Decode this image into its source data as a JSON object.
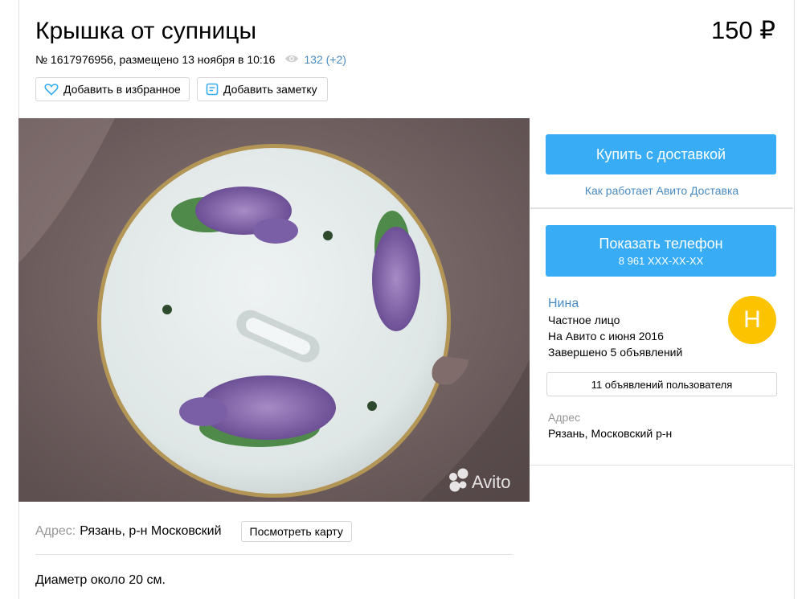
{
  "listing": {
    "title": "Крышка от супницы",
    "price": "150 ₽",
    "meta_text": "№ 1617976956, размещено 13 ноября в 10:16",
    "views": "132 (+2)",
    "favorite_label": "Добавить в избранное",
    "note_label": "Добавить заметку"
  },
  "photo": {
    "watermark": "Avito"
  },
  "delivery": {
    "buy_label": "Купить с доставкой",
    "how_link": "Как работает Авито Доставка"
  },
  "contact": {
    "show_phone_label": "Показать телефон",
    "phone_masked": "8 961 XXX-XX-XX"
  },
  "seller": {
    "name": "Нина",
    "type": "Частное лицо",
    "since": "На Авито с июня 2016",
    "completed": "Завершено 5 объявлений",
    "avatar_letter": "Н",
    "all_ads_label": "11 объявлений пользователя",
    "address_label": "Адрес",
    "address": "Рязань, Московский р-н"
  },
  "location": {
    "label": "Адрес:",
    "value": "Рязань, р-н Московский",
    "map_button": "Посмотреть карту"
  },
  "description": "Диаметр около 20 см.",
  "colors": {
    "accent": "#38adf5",
    "link": "#4a8bc2",
    "avatar": "#fcc400"
  }
}
